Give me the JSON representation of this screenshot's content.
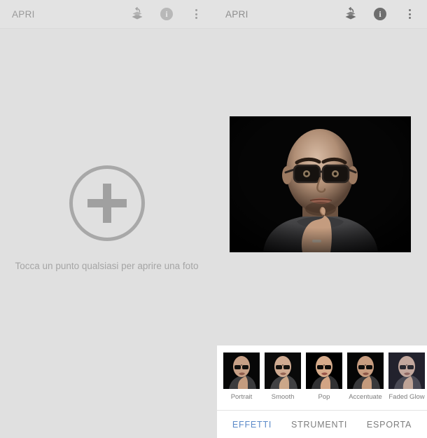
{
  "app": {
    "left_panel": {
      "appbar": {
        "title": "APRI",
        "layers_icon": "layers-icon",
        "info_icon": "info-icon",
        "overflow_icon": "more-vertical-icon",
        "info_glyph": "i"
      },
      "empty_state": {
        "add_icon": "plus-icon",
        "hint": "Tocca un punto qualsiasi per aprire una foto"
      }
    },
    "right_panel": {
      "appbar": {
        "title": "APRI",
        "layers_icon": "layers-icon",
        "info_icon": "info-icon",
        "overflow_icon": "more-vertical-icon",
        "info_glyph": "i"
      },
      "photo": {
        "name": "portrait-photo-bald-man-with-glasses"
      },
      "effects": {
        "items": [
          {
            "label": "Portrait"
          },
          {
            "label": "Smooth"
          },
          {
            "label": "Pop"
          },
          {
            "label": "Accentuate"
          },
          {
            "label": "Faded Glow"
          }
        ]
      },
      "tabs": [
        {
          "label": "EFFETTI",
          "active": true
        },
        {
          "label": "STRUMENTI",
          "active": false
        },
        {
          "label": "ESPORTA",
          "active": false
        }
      ]
    }
  },
  "colors": {
    "background": "#e0e0e0",
    "appbar": "#e3e3e3",
    "accent": "#5b8ac9",
    "muted_text": "#9a9a9a",
    "panel": "#ffffff"
  }
}
